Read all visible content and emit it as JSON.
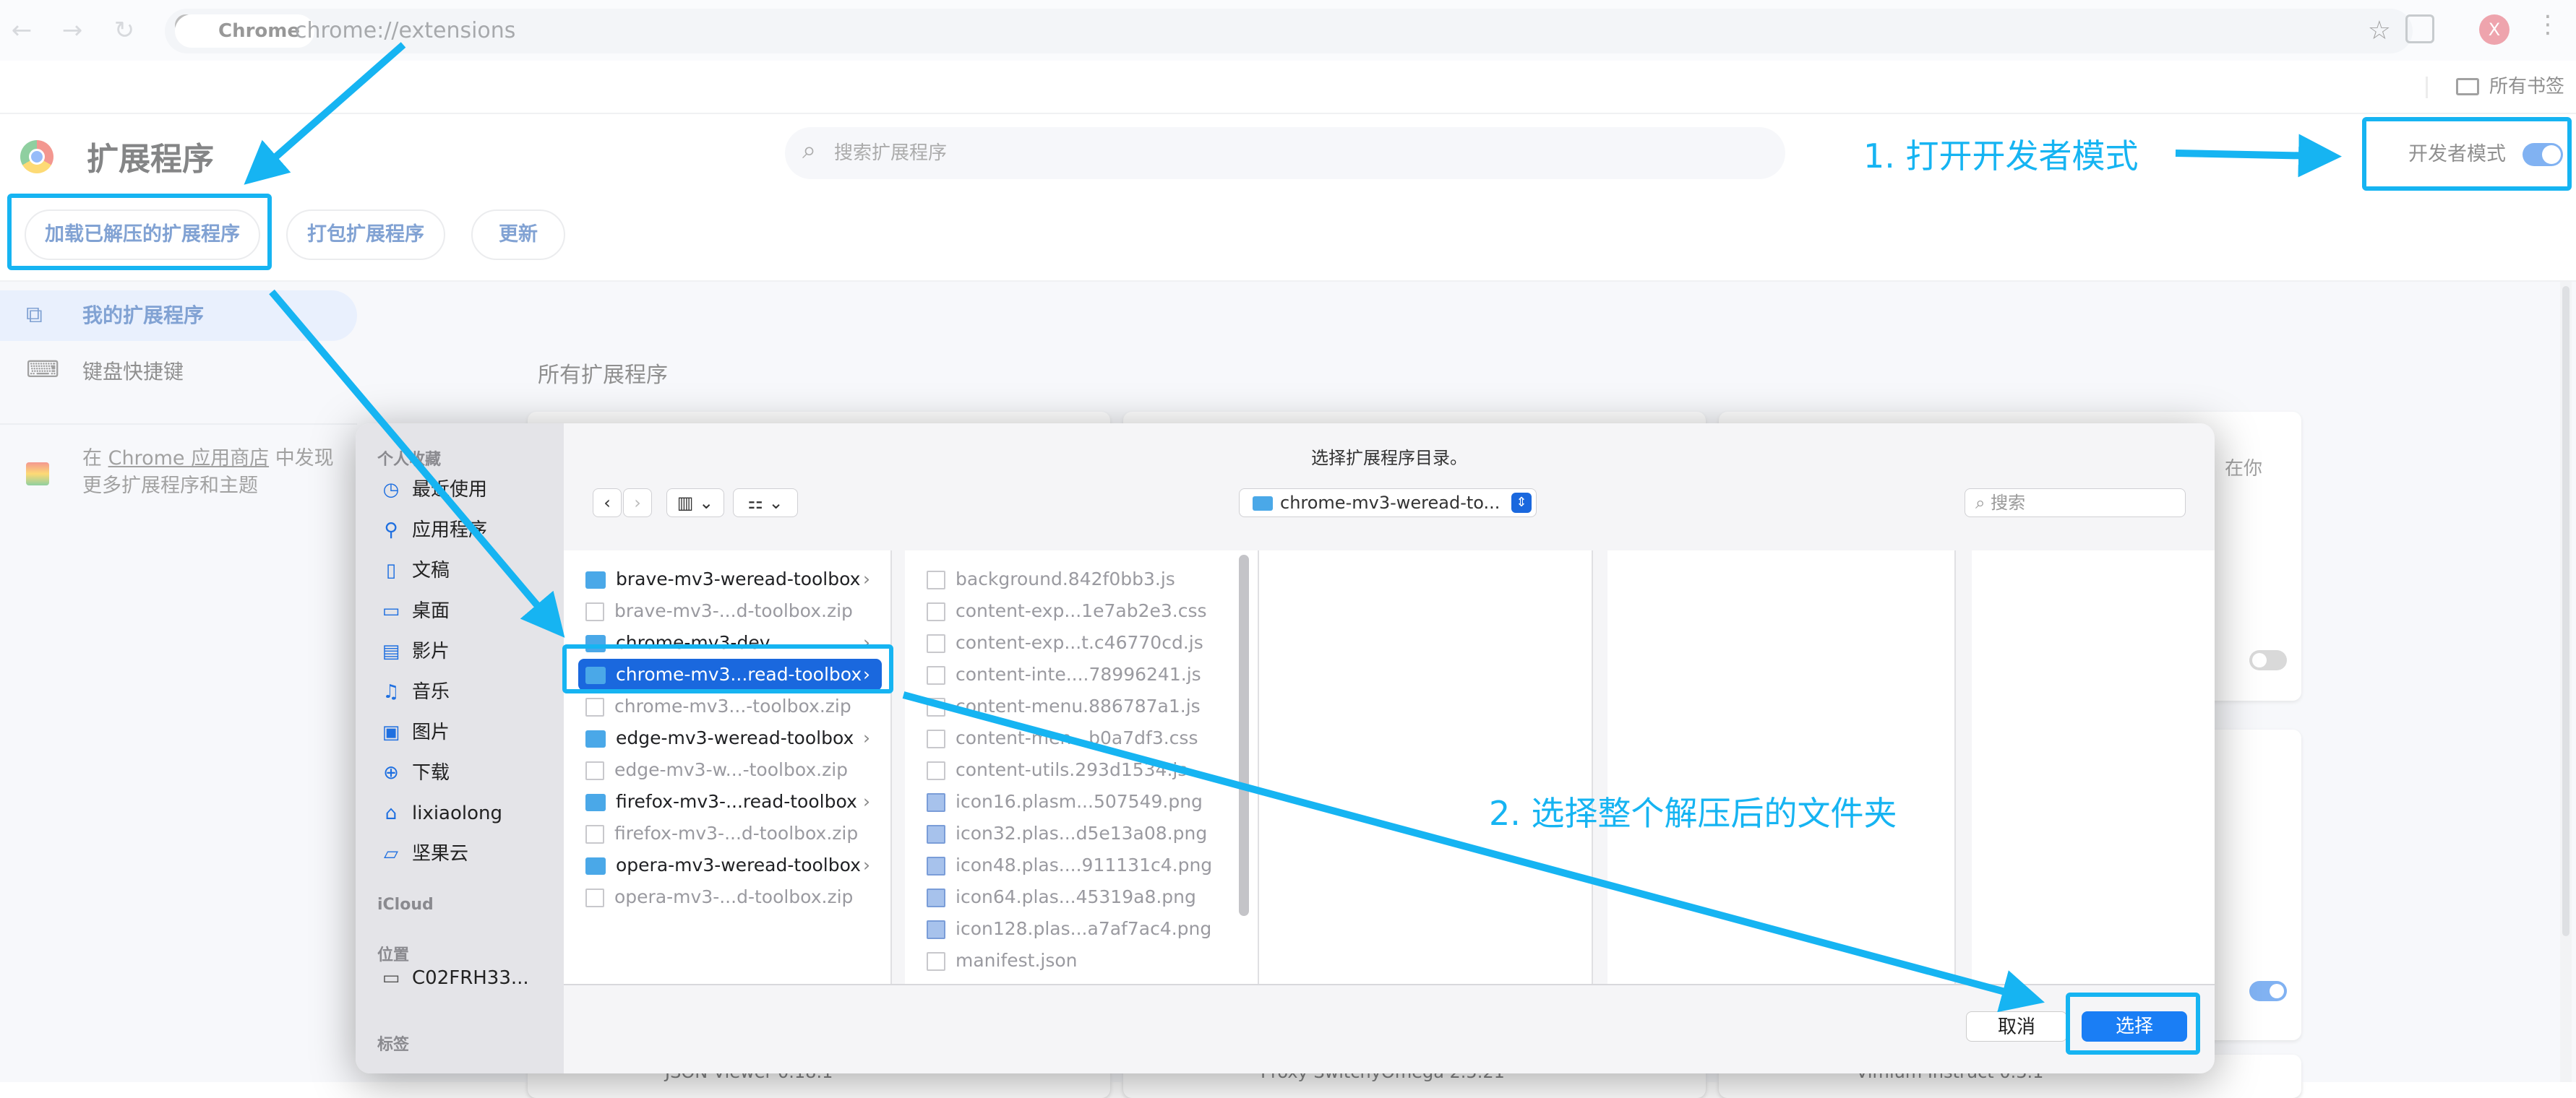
{
  "browser": {
    "chip_label": "Chrome",
    "url": "chrome://extensions",
    "bookmarks_label": "所有书签",
    "profile_initial": "X",
    "colors": {
      "toolbar_bg": "#f6f8fc",
      "profile": "#e05a6b"
    }
  },
  "header": {
    "title": "扩展程序",
    "search_placeholder": "搜索扩展程序",
    "dev_mode_label": "开发者模式",
    "dev_mode_on": true,
    "buttons": {
      "load_unpacked": "加载已解压的扩展程序",
      "pack": "打包扩展程序",
      "update": "更新"
    }
  },
  "sidebar": {
    "items": [
      {
        "label": "我的扩展程序",
        "icon": "extension-icon",
        "active": true
      },
      {
        "label": "键盘快捷键",
        "icon": "keyboard-icon",
        "active": false
      }
    ],
    "store_prefix": "在",
    "store_link": "Chrome 应用商店",
    "store_suffix": "中发现",
    "store_line2": "更多扩展程序和主题"
  },
  "main": {
    "section_title": "所有扩展程序",
    "partial_text": "在你",
    "bottom_cards": [
      "JSON Viewer 0.18.1",
      "Proxy SwitchyOmega 2.5.21",
      "Vimium Instruct 0.3.1"
    ]
  },
  "dialog": {
    "title": "选择扩展程序目录。",
    "path": "chrome-mv3-weread-to...",
    "search_placeholder": "搜索",
    "sidebar": {
      "favorites_header": "个人收藏",
      "favorites": [
        {
          "label": "最近使用",
          "icon": "clock-icon"
        },
        {
          "label": "应用程序",
          "icon": "apps-icon"
        },
        {
          "label": "文稿",
          "icon": "document-icon"
        },
        {
          "label": "桌面",
          "icon": "desktop-icon"
        },
        {
          "label": "影片",
          "icon": "film-icon"
        },
        {
          "label": "音乐",
          "icon": "music-icon"
        },
        {
          "label": "图片",
          "icon": "photo-icon"
        },
        {
          "label": "下载",
          "icon": "download-icon"
        },
        {
          "label": "lixiaolong",
          "icon": "home-icon"
        },
        {
          "label": "坚果云",
          "icon": "folder-icon"
        }
      ],
      "icloud_header": "iCloud",
      "locations_header": "位置",
      "location": "C02FRH33...",
      "tags_header": "标签"
    },
    "column1": [
      {
        "name": "brave-mv3-weread-toolbox",
        "type": "folder",
        "chevron": true
      },
      {
        "name": "brave-mv3-...d-toolbox.zip",
        "type": "zip",
        "chevron": false
      },
      {
        "name": "chrome-mv3-dev",
        "type": "folder",
        "chevron": true
      },
      {
        "name": "chrome-mv3...read-toolbox",
        "type": "folder",
        "chevron": true,
        "selected": true
      },
      {
        "name": "chrome-mv3...-toolbox.zip",
        "type": "zip",
        "chevron": false
      },
      {
        "name": "edge-mv3-weread-toolbox",
        "type": "folder",
        "chevron": true
      },
      {
        "name": "edge-mv3-w...-toolbox.zip",
        "type": "zip",
        "chevron": false
      },
      {
        "name": "firefox-mv3-...read-toolbox",
        "type": "folder",
        "chevron": true
      },
      {
        "name": "firefox-mv3-...d-toolbox.zip",
        "type": "zip",
        "chevron": false
      },
      {
        "name": "opera-mv3-weread-toolbox",
        "type": "folder",
        "chevron": true
      },
      {
        "name": "opera-mv3-...d-toolbox.zip",
        "type": "zip",
        "chevron": false
      }
    ],
    "column2": [
      {
        "name": "background.842f0bb3.js",
        "type": "file"
      },
      {
        "name": "content-exp...1e7ab2e3.css",
        "type": "file"
      },
      {
        "name": "content-exp...t.c46770cd.js",
        "type": "file"
      },
      {
        "name": "content-inte....78996241.js",
        "type": "file"
      },
      {
        "name": "content-menu.886787a1.js",
        "type": "file"
      },
      {
        "name": "content-men...b0a7df3.css",
        "type": "file"
      },
      {
        "name": "content-utils.293d1534.js",
        "type": "file"
      },
      {
        "name": "icon16.plasm...507549.png",
        "type": "image"
      },
      {
        "name": "icon32.plas...d5e13a08.png",
        "type": "image"
      },
      {
        "name": "icon48.plas....911131c4.png",
        "type": "image"
      },
      {
        "name": "icon64.plas...45319a8.png",
        "type": "image"
      },
      {
        "name": "icon128.plas...a7af7ac4.png",
        "type": "image"
      },
      {
        "name": "manifest.json",
        "type": "file"
      }
    ],
    "cancel_label": "取消",
    "select_label": "选择"
  },
  "annotations": {
    "step1": "1. 打开开发者模式",
    "step2": "2. 选择整个解压后的文件夹",
    "color": "#16b4f2"
  }
}
